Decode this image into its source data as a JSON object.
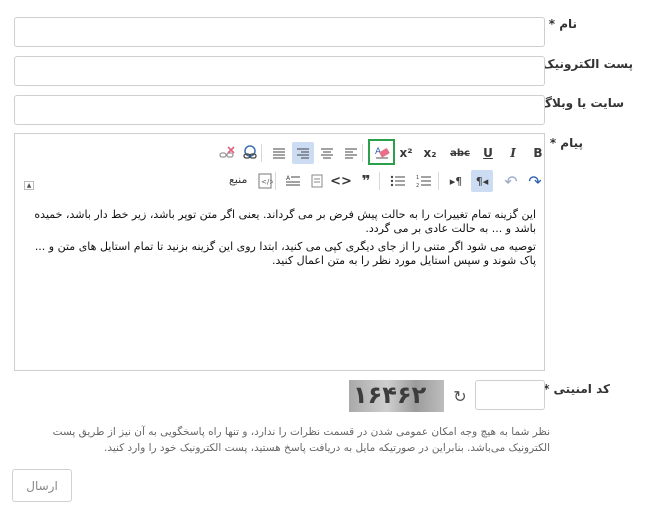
{
  "form": {
    "name_label": "نام *",
    "email_label": "پست الکترونیک",
    "website_label": "سایت یا وبلاگ",
    "message_label": "پیام *",
    "captcha_label": "کد امنیتی *",
    "captcha_text": "۱۶۴۶۲",
    "note": "نظر شما به هیچ وجه امکان عمومی شدن در قسمت نظرات را ندارد، و تنها راه پاسخگویی به آن نیز از طریق پست الکترونیک می‌باشد. بنابراین در صورتیکه مایل به دریافت پاسخ هستید، پست الکترونیک خود را وارد کنید.",
    "submit_label": "ارسال"
  },
  "toolbar": {
    "bold": "B",
    "italic": "I",
    "underline": "U",
    "strike": "abc",
    "subscript": "x₂",
    "superscript": "x²",
    "source_label": "منبع",
    "rtl_label": "¶◂",
    "ltr_label": "▸¶"
  },
  "editor": {
    "paragraph1": "این گزینه تمام تغییرات را به حالت پیش فرض بر می گرداند. یعنی اگر متن توپر باشد، زیر خط دار باشد، خمیده باشد و ... به حالت عادی بر می گردد.",
    "paragraph2": "توصیه می شود اگر متنی را از جای دیگری کپی می کنید، ابتدا روی این گزینه بزنید تا تمام استایل های متن و ... پاک شوند و سپس استایل مورد نظر را به متن اعمال کنید."
  },
  "colors": {
    "highlight_border": "#2aa04b",
    "active_button": "#cbdcf3"
  }
}
